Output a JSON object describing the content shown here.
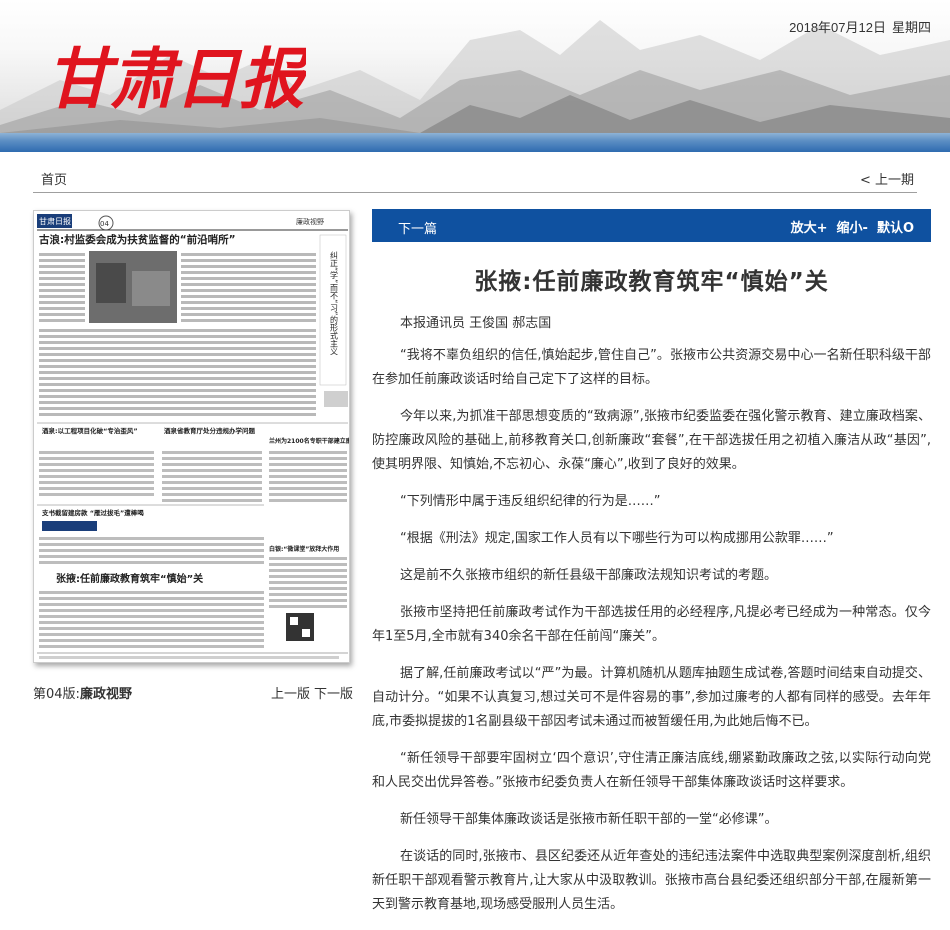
{
  "header": {
    "masthead": "甘肃日报",
    "date": "2018年07月12日",
    "weekday": "星期四"
  },
  "nav": {
    "home": "首页",
    "prev_issue": "< 上一期"
  },
  "page_thumbnail": {
    "paper_name": "甘肃日报",
    "page_no": "04",
    "section_tag": "廉政视野",
    "headlines": [
      "古浪:村监委会成为扶贫监督的“前沿哨所”",
      "纠正“学”而不“习”的形式主义",
      "酒泉:以工程项目化破“专治歪风”",
      "酒泉省教育厅处分违规办学问题",
      "兰州为2100名专职干部建立廉政档案",
      "支书截留建房款 “雁过拔毛”遭棒喝",
      "白银:“微课堂”放拜大作用",
      "张掖:任前廉政教育筑牢“慎始”关"
    ]
  },
  "page_caption": {
    "page_label": "第04版:",
    "page_name": "廉政视野",
    "prev_page": "上一版",
    "next_page": "下一版"
  },
  "article_bar": {
    "next_article": "下一篇",
    "zoom_in": "放大+",
    "zoom_out": "缩小-",
    "default": "默认O"
  },
  "article": {
    "title": "张掖:任前廉政教育筑牢“慎始”关",
    "byline": "本报通讯员 王俊国 郝志国",
    "paragraphs": [
      "“我将不辜负组织的信任,慎始起步,管住自己”。张掖市公共资源交易中心一名新任职科级干部在参加任前廉政谈话时给自己定下了这样的目标。",
      "今年以来,为抓准干部思想变质的“致病源”,张掖市纪委监委在强化警示教育、建立廉政档案、防控廉政风险的基础上,前移教育关口,创新廉政“套餐”,在干部选拔任用之初植入廉洁从政“基因”,使其明界限、知慎始,不忘初心、永葆“廉心”,收到了良好的效果。",
      "“下列情形中属于违反组织纪律的行为是……”",
      "“根据《刑法》规定,国家工作人员有以下哪些行为可以构成挪用公款罪……”",
      "这是前不久张掖市组织的新任县级干部廉政法规知识考试的考题。",
      "张掖市坚持把任前廉政考试作为干部选拔任用的必经程序,凡提必考已经成为一种常态。仅今年1至5月,全市就有340余名干部在任前闯“廉关”。",
      "据了解,任前廉政考试以“严”为最。计算机随机从题库抽题生成试卷,答题时间结束自动提交、自动计分。“如果不认真复习,想过关可不是件容易的事”,参加过廉考的人都有同样的感受。去年年底,市委拟提拔的1名副县级干部因考试未通过而被暂缓任用,为此她后悔不已。",
      "“新任领导干部要牢固树立‘四个意识’,守住清正廉洁底线,绷紧勤政廉政之弦,以实际行动向党和人民交出优异答卷。”张掖市纪委负责人在新任领导干部集体廉政谈话时这样要求。",
      "新任领导干部集体廉政谈话是张掖市新任职干部的一堂“必修课”。",
      "在谈话的同时,张掖市、县区纪委还从近年查处的违纪违法案件中选取典型案例深度剖析,组织新任职干部观看警示教育片,让大家从中汲取教训。张掖市高台县纪委还组织部分干部,在履新第一天到警示教育基地,现场感受服刑人员生活。"
    ]
  },
  "colors": {
    "logo_red": "#e0141e",
    "bar_blue": "#0f51a0",
    "sea_blue": "#2f6bb0"
  }
}
